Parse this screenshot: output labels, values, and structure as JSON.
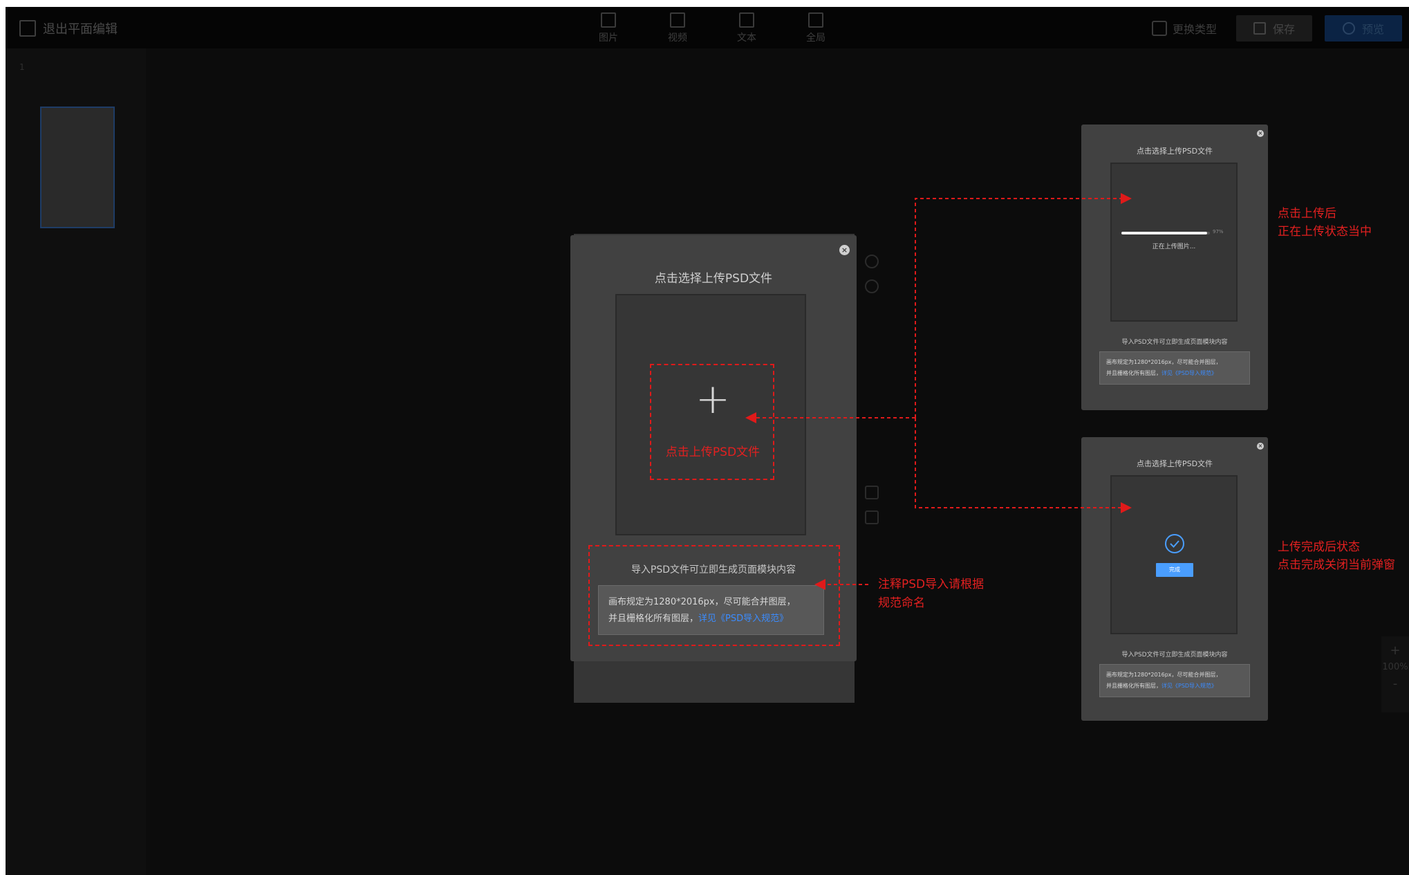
{
  "header": {
    "exit_label": "退出平面编辑",
    "tools": [
      {
        "label": "图片",
        "icon": "image-icon"
      },
      {
        "label": "视频",
        "icon": "video-icon"
      },
      {
        "label": "文本",
        "icon": "text-icon"
      },
      {
        "label": "全局",
        "icon": "global-icon"
      }
    ],
    "change_type_label": "更换类型",
    "save_label": "保存",
    "preview_label": "预览"
  },
  "sidebar": {
    "page_number": "1"
  },
  "main_modal": {
    "title": "点击选择上传PSD文件",
    "upload_plus": "+",
    "upload_caption": "点击上传PSD文件",
    "hint": "导入PSD文件可立即生成页面模块内容",
    "note_line1": "画布规定为1280*2016px，尽可能合并图层，",
    "note_line2_prefix": "并且栅格化所有图层，",
    "note_link": "详见《PSD导入规范》"
  },
  "uploading_modal": {
    "title": "点击选择上传PSD文件",
    "progress_percent": 97,
    "progress_text": "97%",
    "status": "正在上传图片...",
    "hint": "导入PSD文件可立即生成页面模块内容",
    "note_line1": "画布规定为1280*2016px，尽可能合并图层，",
    "note_line2_prefix": "并且栅格化所有图层，",
    "note_link": "详见《PSD导入规范》"
  },
  "done_modal": {
    "title": "点击选择上传PSD文件",
    "done_button": "完成",
    "hint": "导入PSD文件可立即生成页面模块内容",
    "note_line1": "画布规定为1280*2016px，尽可能合并图层，",
    "note_line2_prefix": "并且栅格化所有图层，",
    "note_link": "详见《PSD导入规范》"
  },
  "annotations": {
    "uploading_line1": "点击上传后",
    "uploading_line2": "正在上传状态当中",
    "done_line1": "上传完成后状态",
    "done_line2": "点击完成关闭当前弹窗",
    "note_line1": "注释PSD导入请根据",
    "note_line2": "规范命名"
  },
  "zoom": {
    "plus": "+",
    "level": "100%",
    "minus": "-"
  },
  "colors": {
    "accent": "#3b8cff",
    "annotation": "#e32020",
    "done_button": "#4a9eff"
  }
}
